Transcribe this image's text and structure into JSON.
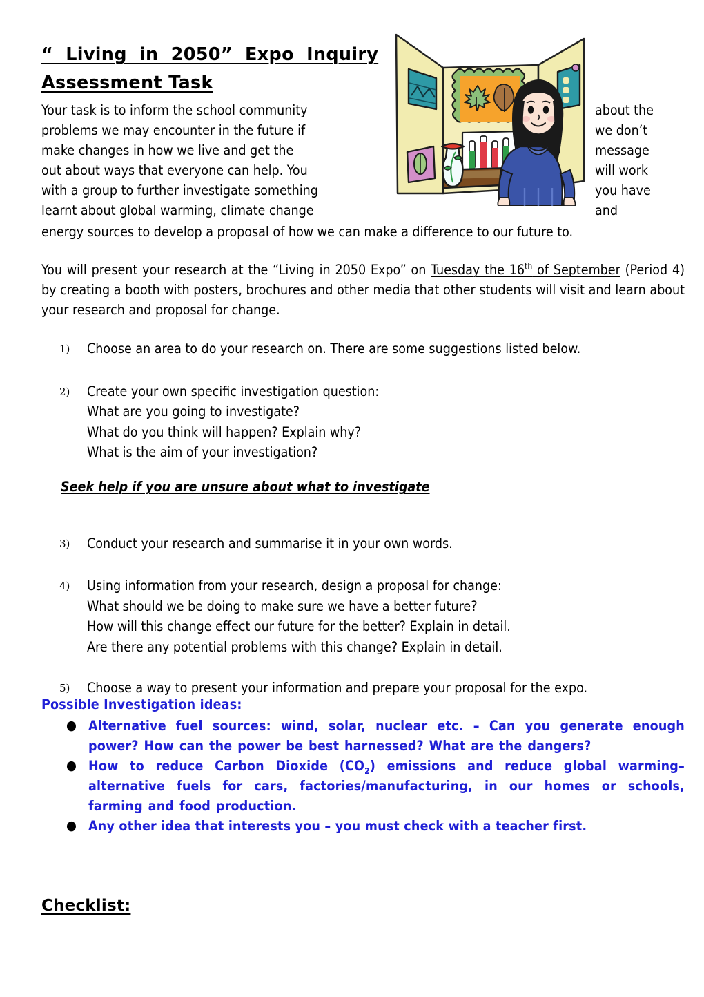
{
  "document": {
    "title_line_1": "“ Living in 2050” Expo Inquiry",
    "title_line_2": "Assessment Task"
  },
  "colors": {
    "text": "#000000",
    "ideas_blue": "#1f1fd6",
    "board_cream": "#f2ecb0",
    "poster_orange": "#f6a32c",
    "poster_teal": "#2e9aa6",
    "poster_pink": "#d38fc9",
    "shirt_blue": "#3a54a8",
    "hair_black": "#1a1a1a",
    "table_brown": "#7a4a1e",
    "leaf_green": "#8cc07a",
    "leaf_brown": "#a87440",
    "tube_red": "#e03a46",
    "tube_green": "#2f9e49",
    "vase_rim_red": "#e03a2e",
    "skin": "#fbe3d4"
  },
  "clipart": {
    "name": "science-fair-booth-girl",
    "description": "Girl standing at a tri-fold science fair display board with posters, a vase and test tubes"
  },
  "intro": {
    "text_before_float": "Your task is to inform the school community",
    "full_text": "Your task is to inform the school community about the problems we may encounter in the future if we don’t make changes in how we live and get the message out about ways that everyone can help.  You will work with a group to further investigate something you have learnt about global warming, climate change and energy sources to develop a proposal of how we can make a difference to our future to.",
    "left_lines": [
      "Your task is to inform the school community",
      "problems we may encounter in the future if",
      "make changes in how we live and get the",
      "out about ways that everyone can help.  You",
      "with a group to further investigate something",
      "learnt about global warming, climate change"
    ],
    "right_lines": [
      "about the",
      "we   don’t",
      "message",
      "will   work",
      "you   have",
      "and"
    ],
    "last_line": "energy sources to develop a proposal of how we can make a difference to our future to."
  },
  "expo_paragraph": {
    "part_1": "You will present your research at the “Living in 2050 Expo” on ",
    "date_underlined_a": "Tuesday the 16",
    "date_superscript": "th",
    "date_underlined_b": " of September",
    "part_2": "(Period 4) by creating a booth with posters, brochures and other media that other students will visit and learn about your research and proposal for change."
  },
  "steps": [
    {
      "number": "1)",
      "lines": [
        "Choose an area to do your research on. There are some suggestions listed below."
      ]
    },
    {
      "number": "2)",
      "lines": [
        "Create your own specific investigation question:",
        "What are you going to investigate?",
        "What do you think will happen? Explain why?",
        "What is the aim of your investigation?"
      ]
    },
    {
      "number": "3)",
      "lines": [
        "Conduct your research and summarise it in your own words."
      ]
    },
    {
      "number": "4)",
      "lines": [
        "Using information from your research, design a proposal for change:",
        "What should we be doing to make sure we have a better future?",
        "How will this change effect our future for the better? Explain in detail.",
        "Are there any potential problems with this change? Explain in detail."
      ]
    },
    {
      "number": "5)",
      "lines": [
        "Choose a way to present your information and prepare your proposal for the expo."
      ]
    }
  ],
  "italic_note": "Seek help if you are unsure about what to investigate",
  "ideas": {
    "heading": "Possible Investigation ideas:",
    "bullet_glyph": "●",
    "items": [
      {
        "text": "Alternative fuel sources: wind, solar, nuclear etc.   – Can you generate enough power? How can the power be best harnessed? What are the dangers?"
      },
      {
        "text_a": "How to reduce Carbon Dioxide (CO",
        "subscript": "2",
        "text_b": ") emissions and reduce global warming– alternative fuels for cars, factories/manufacturing, in our homes or schools, farming and food production."
      },
      {
        "text": "Any other idea that interests you – you must check with a teacher first."
      }
    ]
  },
  "checklist": {
    "heading": "Checklist:"
  }
}
